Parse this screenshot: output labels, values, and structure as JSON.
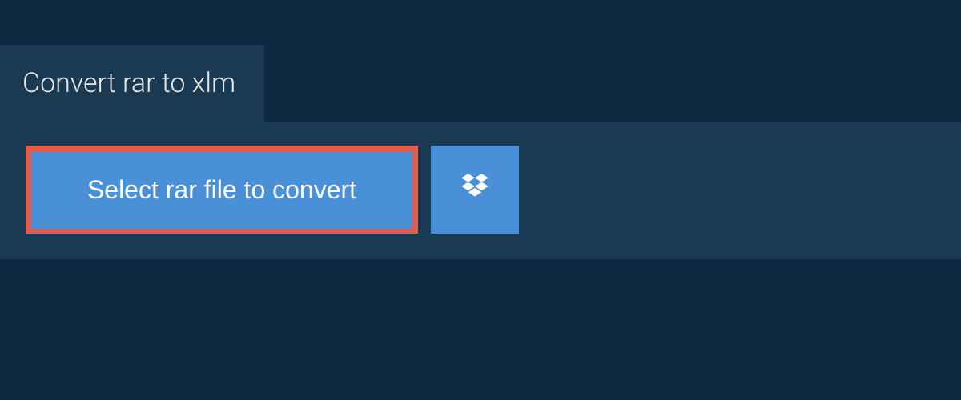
{
  "header": {
    "title": "Convert rar to xlm"
  },
  "controls": {
    "select_file_label": "Select rar file to convert"
  },
  "colors": {
    "background": "#0e2a42",
    "panel": "#1a3a54",
    "button": "#4a90d9",
    "highlight_border": "#e05e50"
  }
}
